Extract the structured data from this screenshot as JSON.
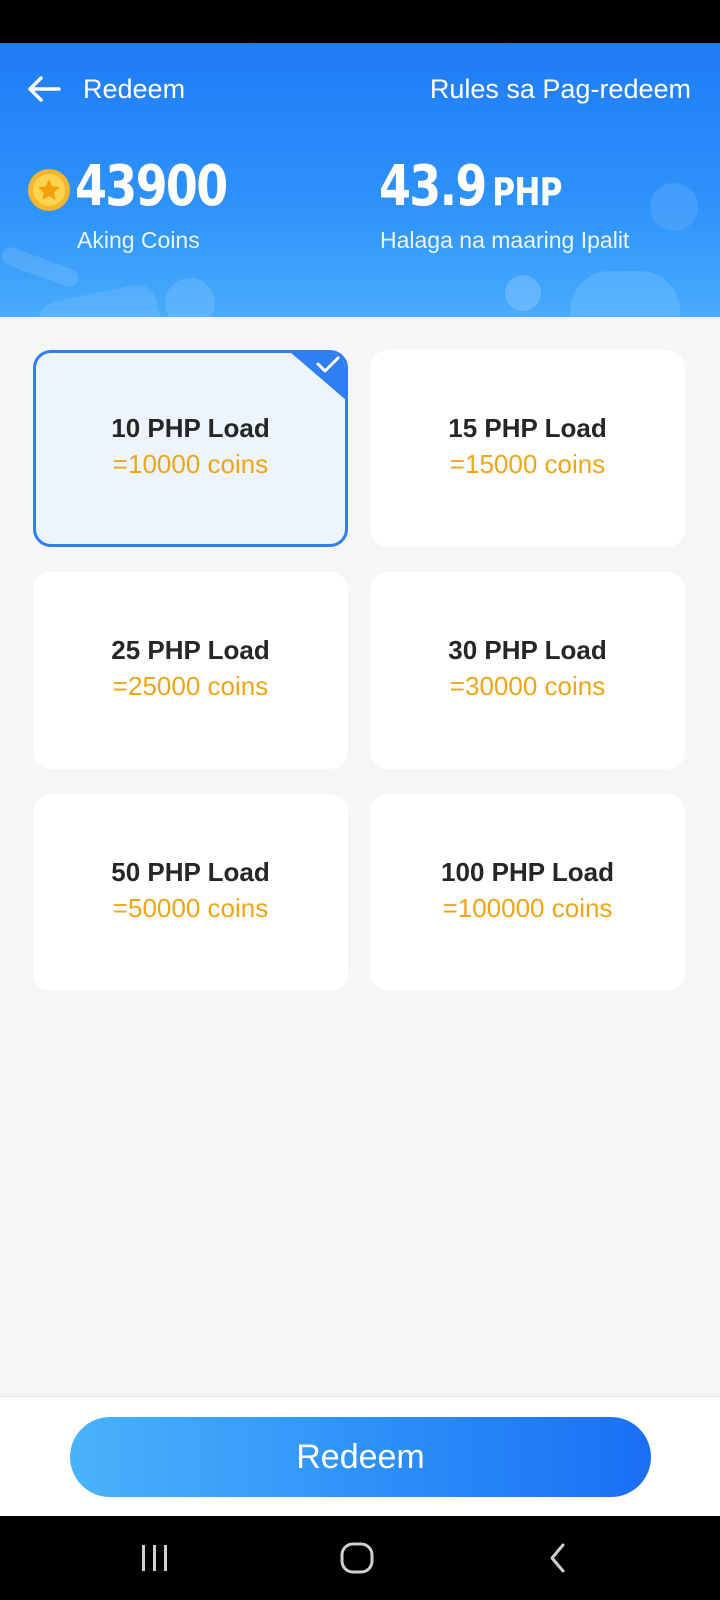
{
  "header": {
    "title": "Redeem",
    "rules_link": "Rules sa Pag-redeem",
    "coins_value": "43900",
    "coins_label": "Aking Coins",
    "php_value": "43.9",
    "php_unit": "PHP",
    "php_label": "Halaga na maaring Ipalit",
    "back_icon": "arrow-left-icon",
    "coin_icon": "star-coin-icon"
  },
  "options": [
    {
      "title": "10 PHP Load",
      "coins": "=10000 coins",
      "selected": true
    },
    {
      "title": "15 PHP Load",
      "coins": "=15000 coins",
      "selected": false
    },
    {
      "title": "25 PHP Load",
      "coins": "=25000 coins",
      "selected": false
    },
    {
      "title": "30 PHP Load",
      "coins": "=30000 coins",
      "selected": false
    },
    {
      "title": "50 PHP Load",
      "coins": "=50000 coins",
      "selected": false
    },
    {
      "title": "100 PHP Load",
      "coins": "=100000 coins",
      "selected": false
    }
  ],
  "footer": {
    "redeem_label": "Redeem"
  },
  "nav": {
    "icons": [
      "recent-apps-icon",
      "home-icon",
      "back-icon"
    ]
  },
  "colors": {
    "accent": "#2f7ff3",
    "coin_text": "#f0a516",
    "header_blue": "#1f7bf7"
  }
}
